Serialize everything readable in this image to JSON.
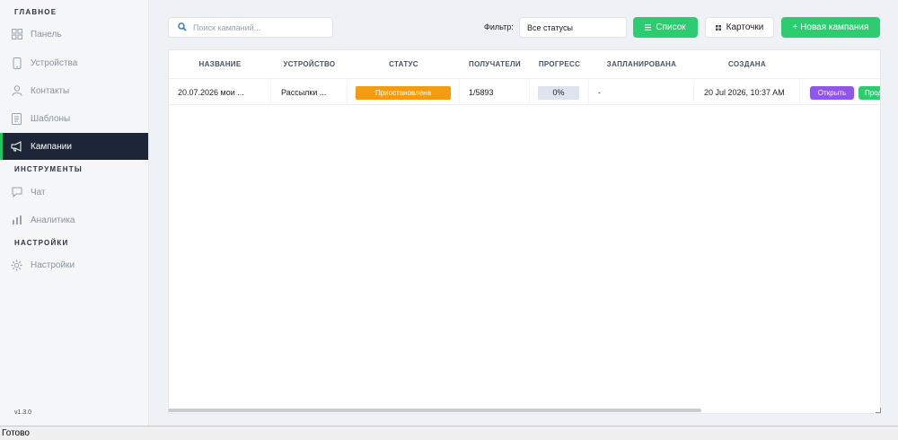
{
  "sidebar": {
    "sections": {
      "main": "ГЛАВНОЕ",
      "tools": "ИНСТРУМЕНТЫ",
      "settings": "НАСТРОЙКИ"
    },
    "items": [
      {
        "label": "Панель",
        "icon": "grid-icon"
      },
      {
        "label": "Устройства",
        "icon": "phone-icon"
      },
      {
        "label": "Контакты",
        "icon": "user-icon"
      },
      {
        "label": "Шаблоны",
        "icon": "document-icon"
      },
      {
        "label": "Кампании",
        "icon": "megaphone-icon",
        "active": true
      },
      {
        "label": "Чат",
        "icon": "chat-icon"
      },
      {
        "label": "Аналитика",
        "icon": "bar-chart-icon"
      },
      {
        "label": "Настройки",
        "icon": "gear-icon"
      }
    ],
    "version": "v1.3.0"
  },
  "toolbar": {
    "search_placeholder": "Поиск кампаний...",
    "filter_label": "Фильтр:",
    "filter_value": "Все статусы",
    "list_button": "Список",
    "cards_button": "Карточки",
    "new_campaign_button": "+ Новая кампания"
  },
  "table": {
    "headers": [
      "НАЗВАНИЕ",
      "УСТРОЙСТВО",
      "СТАТУС",
      "ПОЛУЧАТЕЛИ",
      "ПРОГРЕСС",
      "ЗАПЛАНИРОВАНА",
      "СОЗДАНА"
    ],
    "rows": [
      {
        "name": "20.07.2026 мои ...",
        "device": "Рассылки ...",
        "status": "Приостановлена",
        "recipients": "1/5893",
        "progress": "0%",
        "scheduled": "-",
        "created": "20 Jul 2026, 10:37 AM",
        "open_button": "Открыть",
        "continue_button": "Продолжить"
      }
    ]
  },
  "colors": {
    "accent_green": "#2ecc71",
    "sidebar_active_bg": "#1c2636",
    "status_paused": "#f39c12",
    "open_button": "#8e57e8"
  },
  "statusbar": {
    "text": "Готово"
  }
}
